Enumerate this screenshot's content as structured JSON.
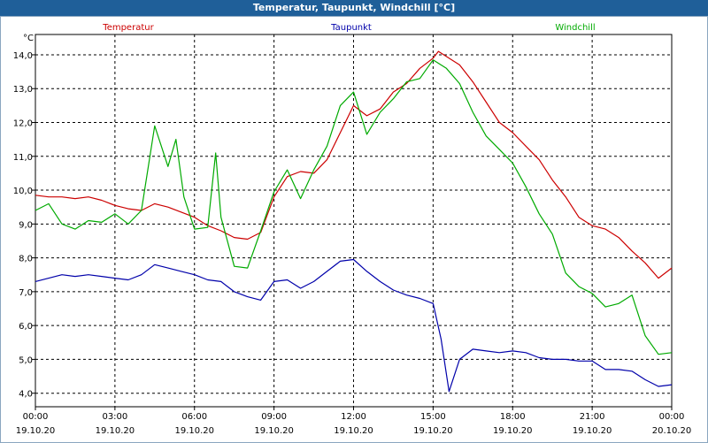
{
  "window": {
    "title": "Temperatur, Taupunkt, Windchill [°C]"
  },
  "chart_data": {
    "type": "line",
    "title": "Temperatur, Taupunkt, Windchill [°C]",
    "ylabel": "°C",
    "xlabel": "",
    "ylim": [
      3.6,
      14.6
    ],
    "xlim": [
      0,
      24
    ],
    "grid": true,
    "legend_placement": "top",
    "y_ticks": [
      "4,0",
      "5,0",
      "6,0",
      "7,0",
      "8,0",
      "9,0",
      "10,0",
      "11,0",
      "12,0",
      "13,0",
      "14,0"
    ],
    "x_ticks": [
      {
        "time": "00:00",
        "date": "19.10.20"
      },
      {
        "time": "03:00",
        "date": "19.10.20"
      },
      {
        "time": "06:00",
        "date": "19.10.20"
      },
      {
        "time": "09:00",
        "date": "19.10.20"
      },
      {
        "time": "12:00",
        "date": "19.10.20"
      },
      {
        "time": "15:00",
        "date": "19.10.20"
      },
      {
        "time": "18:00",
        "date": "19.10.20"
      },
      {
        "time": "21:00",
        "date": "19.10.20"
      },
      {
        "time": "00:00",
        "date": "20.10.20"
      }
    ],
    "x_unit_note": "",
    "series": [
      {
        "name": "Temperatur",
        "color": "#cc0000",
        "points": [
          [
            0,
            9.85
          ],
          [
            0.5,
            9.8
          ],
          [
            1,
            9.8
          ],
          [
            1.5,
            9.75
          ],
          [
            2,
            9.8
          ],
          [
            2.5,
            9.7
          ],
          [
            3,
            9.55
          ],
          [
            3.5,
            9.45
          ],
          [
            4,
            9.4
          ],
          [
            4.5,
            9.6
          ],
          [
            5,
            9.5
          ],
          [
            5.5,
            9.35
          ],
          [
            6,
            9.2
          ],
          [
            6.5,
            8.95
          ],
          [
            7,
            8.8
          ],
          [
            7.5,
            8.6
          ],
          [
            8,
            8.55
          ],
          [
            8.5,
            8.75
          ],
          [
            9,
            9.8
          ],
          [
            9.5,
            10.4
          ],
          [
            10,
            10.55
          ],
          [
            10.5,
            10.5
          ],
          [
            11,
            10.9
          ],
          [
            11.5,
            11.7
          ],
          [
            12,
            12.5
          ],
          [
            12.5,
            12.2
          ],
          [
            13,
            12.4
          ],
          [
            13.5,
            12.9
          ],
          [
            14,
            13.15
          ],
          [
            14.5,
            13.6
          ],
          [
            15,
            13.9
          ],
          [
            15.2,
            14.1
          ],
          [
            15.5,
            13.95
          ],
          [
            16,
            13.7
          ],
          [
            16.5,
            13.2
          ],
          [
            17,
            12.6
          ],
          [
            17.5,
            12.0
          ],
          [
            18,
            11.7
          ],
          [
            18.5,
            11.3
          ],
          [
            19,
            10.9
          ],
          [
            19.5,
            10.3
          ],
          [
            20,
            9.8
          ],
          [
            20.5,
            9.2
          ],
          [
            21,
            8.95
          ],
          [
            21.5,
            8.85
          ],
          [
            22,
            8.6
          ],
          [
            22.5,
            8.2
          ],
          [
            23,
            7.85
          ],
          [
            23.5,
            7.4
          ],
          [
            24,
            7.7
          ]
        ]
      },
      {
        "name": "Taupunkt",
        "color": "#0000aa",
        "points": [
          [
            0,
            7.3
          ],
          [
            0.5,
            7.4
          ],
          [
            1,
            7.5
          ],
          [
            1.5,
            7.45
          ],
          [
            2,
            7.5
          ],
          [
            2.5,
            7.45
          ],
          [
            3,
            7.4
          ],
          [
            3.5,
            7.35
          ],
          [
            4,
            7.5
          ],
          [
            4.5,
            7.8
          ],
          [
            5,
            7.7
          ],
          [
            5.5,
            7.6
          ],
          [
            6,
            7.5
          ],
          [
            6.5,
            7.35
          ],
          [
            7,
            7.3
          ],
          [
            7.5,
            7.0
          ],
          [
            8,
            6.85
          ],
          [
            8.5,
            6.75
          ],
          [
            9,
            7.3
          ],
          [
            9.5,
            7.35
          ],
          [
            10,
            7.1
          ],
          [
            10.5,
            7.3
          ],
          [
            11,
            7.6
          ],
          [
            11.5,
            7.9
          ],
          [
            12,
            7.95
          ],
          [
            12.5,
            7.6
          ],
          [
            13,
            7.3
          ],
          [
            13.5,
            7.05
          ],
          [
            14,
            6.9
          ],
          [
            14.5,
            6.8
          ],
          [
            15,
            6.65
          ],
          [
            15.3,
            5.6
          ],
          [
            15.6,
            4.05
          ],
          [
            16,
            5.0
          ],
          [
            16.5,
            5.3
          ],
          [
            17,
            5.25
          ],
          [
            17.5,
            5.2
          ],
          [
            18,
            5.25
          ],
          [
            18.5,
            5.2
          ],
          [
            19,
            5.05
          ],
          [
            19.5,
            5.0
          ],
          [
            20,
            5.0
          ],
          [
            20.5,
            4.95
          ],
          [
            21,
            4.95
          ],
          [
            21.5,
            4.7
          ],
          [
            22,
            4.7
          ],
          [
            22.5,
            4.65
          ],
          [
            23,
            4.4
          ],
          [
            23.5,
            4.2
          ],
          [
            24,
            4.25
          ]
        ]
      },
      {
        "name": "Windchill",
        "color": "#00aa00",
        "points": [
          [
            0,
            9.4
          ],
          [
            0.5,
            9.6
          ],
          [
            1,
            9.0
          ],
          [
            1.5,
            8.85
          ],
          [
            2,
            9.1
          ],
          [
            2.5,
            9.05
          ],
          [
            3,
            9.3
          ],
          [
            3.5,
            9.0
          ],
          [
            4,
            9.4
          ],
          [
            4.5,
            11.9
          ],
          [
            5,
            10.7
          ],
          [
            5.3,
            11.5
          ],
          [
            5.6,
            9.8
          ],
          [
            6,
            8.85
          ],
          [
            6.5,
            8.9
          ],
          [
            6.8,
            11.1
          ],
          [
            7,
            9.2
          ],
          [
            7.5,
            7.75
          ],
          [
            8,
            7.7
          ],
          [
            8.5,
            8.8
          ],
          [
            9,
            9.95
          ],
          [
            9.5,
            10.6
          ],
          [
            10,
            9.75
          ],
          [
            10.5,
            10.6
          ],
          [
            11,
            11.3
          ],
          [
            11.5,
            12.5
          ],
          [
            12,
            12.9
          ],
          [
            12.5,
            11.65
          ],
          [
            13,
            12.3
          ],
          [
            13.5,
            12.7
          ],
          [
            14,
            13.2
          ],
          [
            14.5,
            13.3
          ],
          [
            15,
            13.85
          ],
          [
            15.5,
            13.6
          ],
          [
            16,
            13.15
          ],
          [
            16.5,
            12.3
          ],
          [
            17,
            11.6
          ],
          [
            17.5,
            11.2
          ],
          [
            18,
            10.8
          ],
          [
            18.5,
            10.1
          ],
          [
            19,
            9.3
          ],
          [
            19.5,
            8.7
          ],
          [
            20,
            7.55
          ],
          [
            20.5,
            7.15
          ],
          [
            21,
            6.95
          ],
          [
            21.5,
            6.55
          ],
          [
            22,
            6.65
          ],
          [
            22.5,
            6.9
          ],
          [
            23,
            5.7
          ],
          [
            23.5,
            5.15
          ],
          [
            24,
            5.2
          ]
        ]
      }
    ]
  }
}
